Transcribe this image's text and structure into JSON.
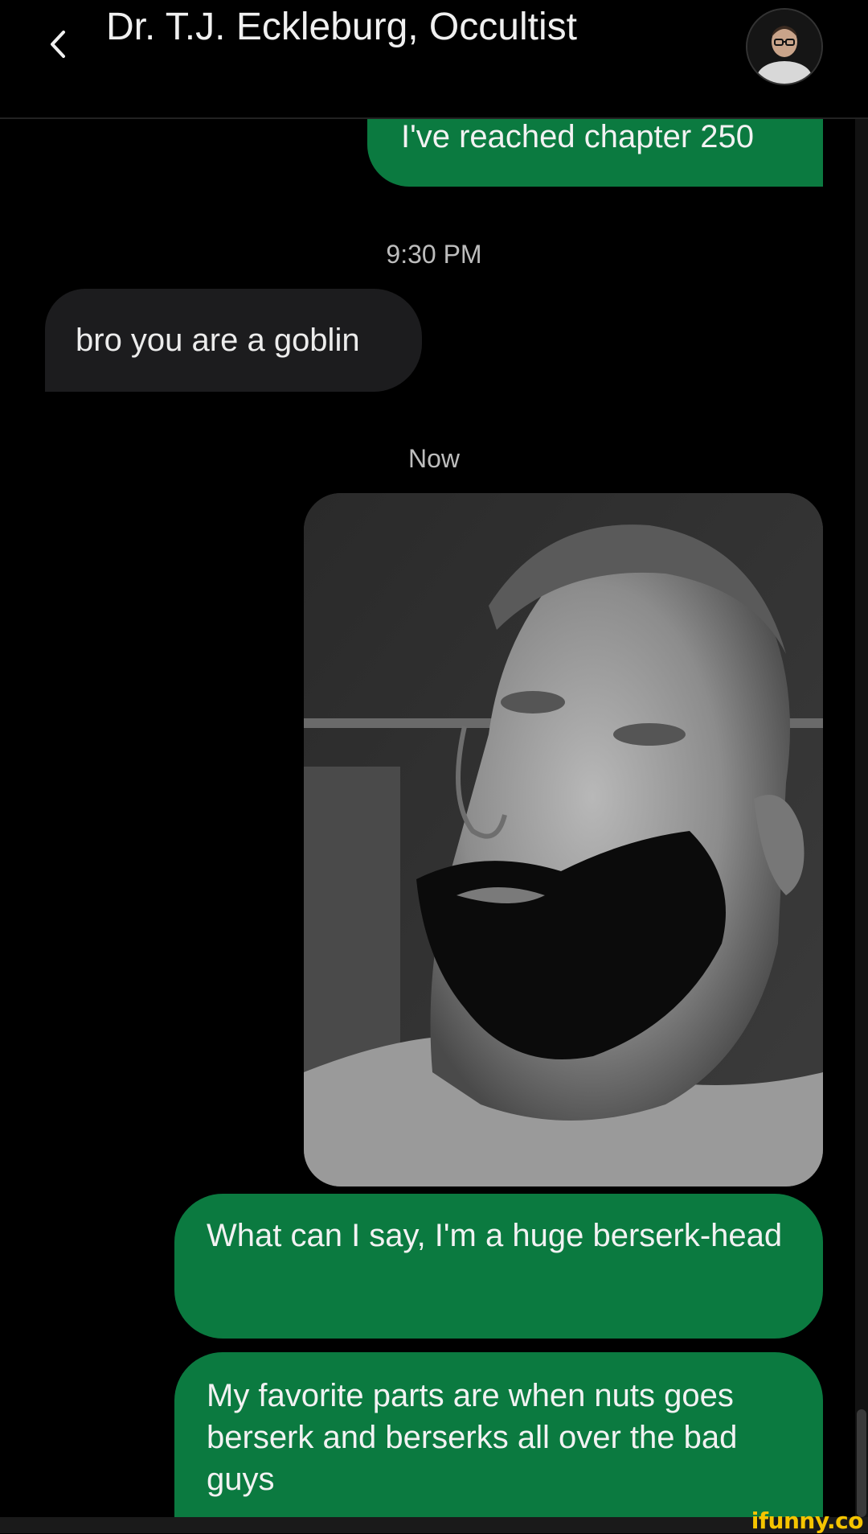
{
  "header": {
    "contact_name": "Dr. T.J. Eckleburg, Occultist"
  },
  "messages": [
    {
      "direction": "sent",
      "text": "I've reached chapter 250"
    },
    {
      "direction": "received",
      "text": "bro you are a goblin"
    },
    {
      "direction": "sent",
      "text": "What can I say, I'm a huge berserk-head"
    },
    {
      "direction": "sent",
      "text": "My favorite parts are when nuts goes berserk and berserks all over the bad guys"
    }
  ],
  "timestamps": [
    "9:30 PM",
    "Now"
  ],
  "watermark": "ifunny.co",
  "colors": {
    "background": "#000000",
    "sent_bubble": "#0b7a40",
    "received_bubble": "#1c1c1e",
    "text": "#ececec",
    "timestamp": "#bdbdbd",
    "watermark": "#f5c400"
  },
  "icons": {
    "back": "chevron-left-icon",
    "avatar": "contact-avatar"
  }
}
